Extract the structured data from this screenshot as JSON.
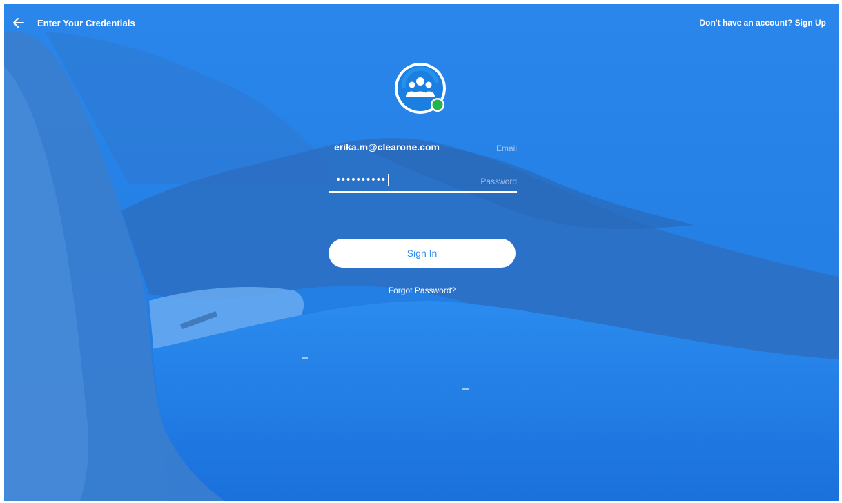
{
  "header": {
    "title": "Enter Your Credentials",
    "back_icon": "arrow-left-icon",
    "signup_link": "Don't have an account? Sign Up"
  },
  "logo": {
    "icon": "group-people-icon",
    "status_color": "#22b54a"
  },
  "form": {
    "email_value": "erika.m@clearone.com",
    "email_label": "Email",
    "password_value": "••••••••••",
    "password_label": "Password",
    "signin_label": "Sign In",
    "forgot_label": "Forgot Password?"
  },
  "colors": {
    "overlay": "#1f7fe4",
    "button_text": "#2d8ef0",
    "text": "#ffffff"
  }
}
